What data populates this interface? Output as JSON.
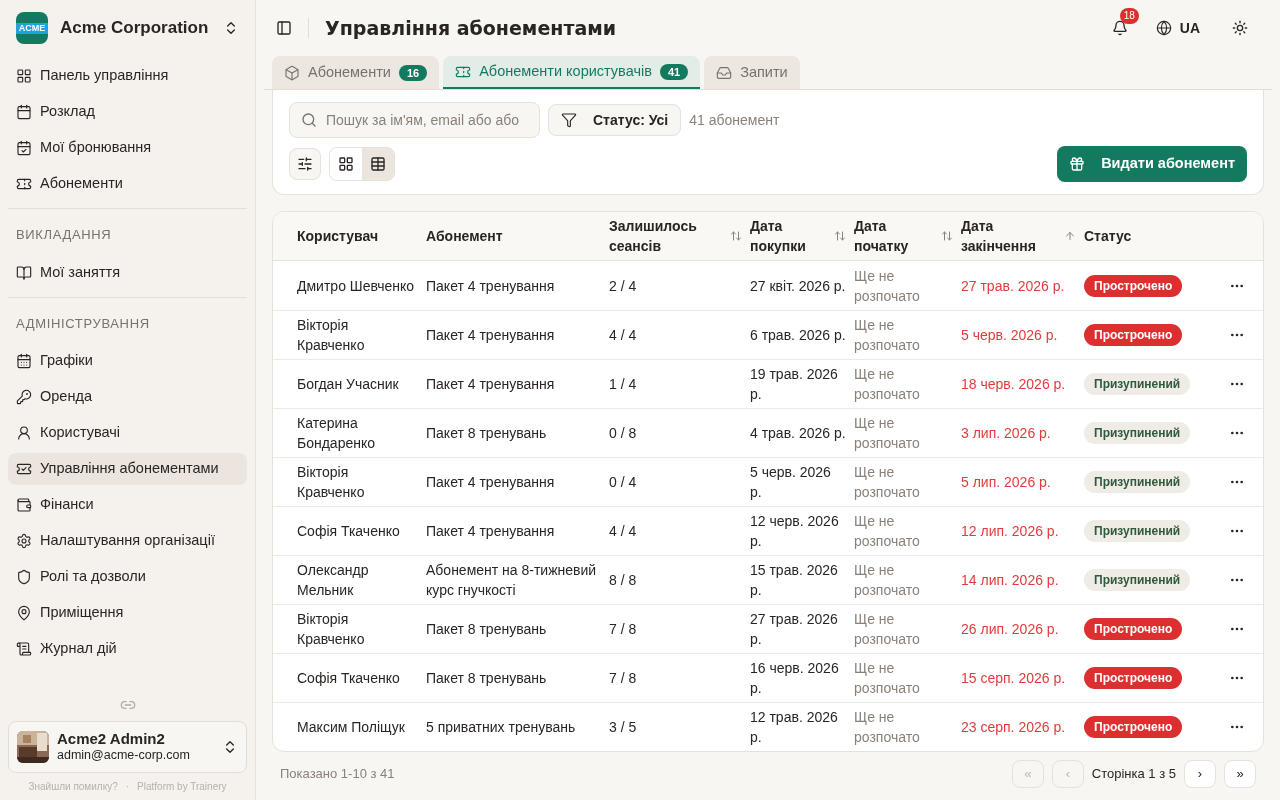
{
  "org": {
    "logo_text": "ACME",
    "name": "Acme Corporation"
  },
  "sidebar": {
    "sections": [
      {
        "items": [
          {
            "label": "Панель управління",
            "selected": false
          },
          {
            "label": "Розклад",
            "selected": false
          },
          {
            "label": "Мої бронювання",
            "selected": false
          },
          {
            "label": "Абонементи",
            "selected": false
          }
        ]
      },
      {
        "title": "ВИКЛАДАННЯ",
        "items": [
          {
            "label": "Мої заняття",
            "selected": false
          }
        ]
      },
      {
        "title": "АДМІНІСТРУВАННЯ",
        "items": [
          {
            "label": "Графіки",
            "selected": false
          },
          {
            "label": "Оренда",
            "selected": false
          },
          {
            "label": "Користувачі",
            "selected": false
          },
          {
            "label": "Управління абонементами",
            "selected": true
          },
          {
            "label": "Фінанси",
            "selected": false
          },
          {
            "label": "Налаштування організації",
            "selected": false
          },
          {
            "label": "Ролі та дозволи",
            "selected": false
          },
          {
            "label": "Приміщення",
            "selected": false
          },
          {
            "label": "Журнал дій",
            "selected": false
          }
        ]
      }
    ]
  },
  "user": {
    "name": "Acme2 Admin2",
    "email": "admin@acme-corp.com"
  },
  "footer_links": [
    "Знайшли помилку?",
    "·",
    "Platform by Trainery"
  ],
  "header": {
    "title": "Управління абонементами",
    "notifications": "18",
    "language": "UA"
  },
  "tabs": [
    {
      "label": "Абонементи",
      "count": "16",
      "selected": false
    },
    {
      "label": "Абонементи користувачів",
      "count": "41",
      "selected": true
    },
    {
      "label": "Запити",
      "selected": false
    }
  ],
  "filters": {
    "search_placeholder": "Пошук за ім'ям, email або або",
    "status_filter": "Статус: Усі",
    "result_count": "41 абонемент",
    "views": [
      {
        "kind": "grid",
        "selected": false
      },
      {
        "kind": "table",
        "selected": true
      }
    ],
    "issue_button": "Видати абонемент"
  },
  "table": {
    "columns": [
      {
        "label": "Користувач",
        "kind": "plain"
      },
      {
        "label": "Абонемент",
        "kind": "plain"
      },
      {
        "label": "Залишилось сеансів",
        "kind": "sortable"
      },
      {
        "label": "Дата покупки",
        "kind": "sortable"
      },
      {
        "label": "Дата початку",
        "kind": "sortable"
      },
      {
        "label": "Дата закінчення",
        "kind": "sorted"
      },
      {
        "label": "Статус",
        "kind": "plain"
      }
    ],
    "rows": [
      {
        "user": "Дмитро Шевченко",
        "pass": "Пакет 4 тренування",
        "sessions": "2 / 4",
        "purchased": "27 квіт. 2026 р.",
        "start": "Ще не розпочато",
        "end": "27 трав. 2026 р.",
        "status": {
          "kind": "overdue",
          "label": "Прострочено"
        }
      },
      {
        "user": "Вікторія Кравченко",
        "pass": "Пакет 4 тренування",
        "sessions": "4 / 4",
        "purchased": "6 трав. 2026 р.",
        "start": "Ще не розпочато",
        "end": "5 черв. 2026 р.",
        "status": {
          "kind": "overdue",
          "label": "Прострочено"
        }
      },
      {
        "user": "Богдан Учасник",
        "pass": "Пакет 4 тренування",
        "sessions": "1 / 4",
        "purchased": "19 трав. 2026 р.",
        "start": "Ще не розпочато",
        "end": "18 черв. 2026 р.",
        "status": {
          "kind": "paused",
          "label": "Призупинений"
        }
      },
      {
        "user": "Катерина Бондаренко",
        "pass": "Пакет 8 тренувань",
        "sessions": "0 / 8",
        "purchased": "4 трав. 2026 р.",
        "start": "Ще не розпочато",
        "end": "3 лип. 2026 р.",
        "status": {
          "kind": "paused",
          "label": "Призупинений"
        }
      },
      {
        "user": "Вікторія Кравченко",
        "pass": "Пакет 4 тренування",
        "sessions": "0 / 4",
        "purchased": "5 черв. 2026 р.",
        "start": "Ще не розпочато",
        "end": "5 лип. 2026 р.",
        "status": {
          "kind": "paused",
          "label": "Призупинений"
        }
      },
      {
        "user": "Софія Ткаченко",
        "pass": "Пакет 4 тренування",
        "sessions": "4 / 4",
        "purchased": "12 черв. 2026 р.",
        "start": "Ще не розпочато",
        "end": "12 лип. 2026 р.",
        "status": {
          "kind": "paused",
          "label": "Призупинений"
        }
      },
      {
        "user": "Олександр Мельник",
        "pass": "Абонемент на 8-тижневий курс гнучкості",
        "sessions": "8 / 8",
        "purchased": "15 трав. 2026 р.",
        "start": "Ще не розпочато",
        "end": "14 лип. 2026 р.",
        "status": {
          "kind": "paused",
          "label": "Призупинений"
        }
      },
      {
        "user": "Вікторія Кравченко",
        "pass": "Пакет 8 тренувань",
        "sessions": "7 / 8",
        "purchased": "27 трав. 2026 р.",
        "start": "Ще не розпочато",
        "end": "26 лип. 2026 р.",
        "status": {
          "kind": "overdue",
          "label": "Прострочено"
        }
      },
      {
        "user": "Софія Ткаченко",
        "pass": "Пакет 8 тренувань",
        "sessions": "7 / 8",
        "purchased": "16 черв. 2026 р.",
        "start": "Ще не розпочато",
        "end": "15 серп. 2026 р.",
        "status": {
          "kind": "overdue",
          "label": "Прострочено"
        }
      },
      {
        "user": "Максим Поліщук",
        "pass": "5 приватних тренувань",
        "sessions": "3 / 5",
        "purchased": "12 трав. 2026 р.",
        "start": "Ще не розпочато",
        "end": "23 серп. 2026 р.",
        "status": {
          "kind": "overdue",
          "label": "Прострочено"
        }
      }
    ]
  },
  "pagination": {
    "summary": "Показано 1-10 з 41",
    "page": "Сторінка 1 з 5",
    "buttons": [
      "«",
      "‹",
      "›",
      "»"
    ]
  }
}
